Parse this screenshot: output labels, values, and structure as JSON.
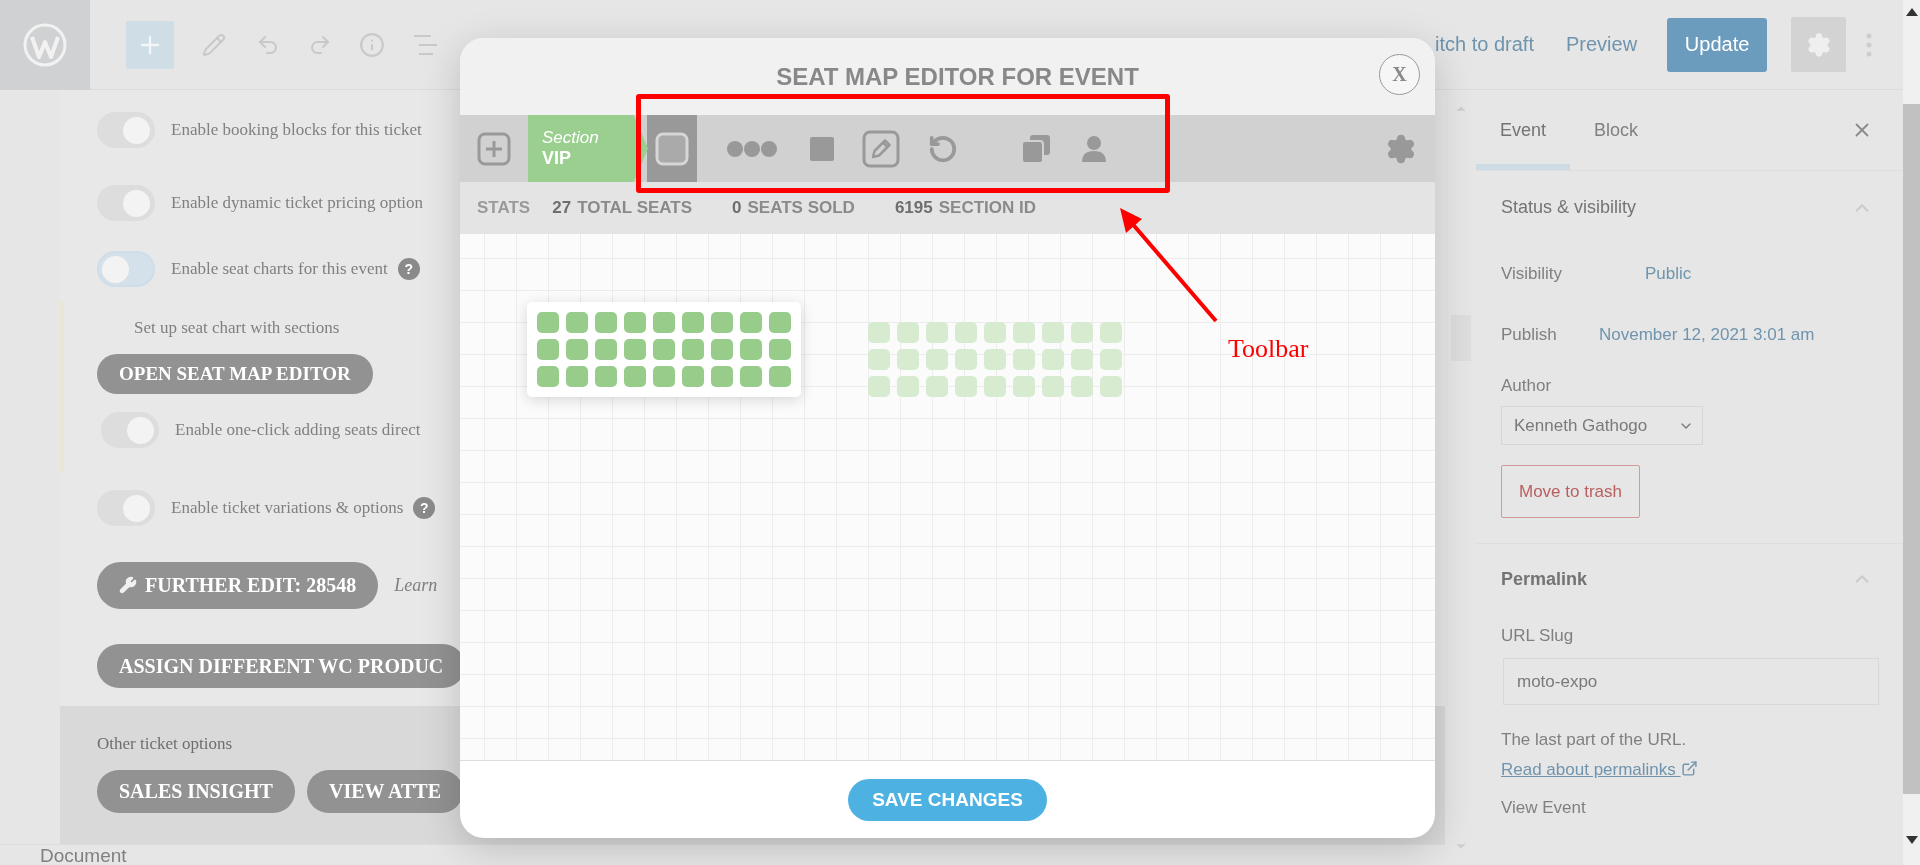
{
  "top_bar": {
    "switch_to_draft": "itch to draft",
    "preview": "Preview",
    "update": "Update"
  },
  "ticket_settings": {
    "toggles": [
      {
        "label": "Enable booking blocks for this ticket",
        "on": true
      },
      {
        "label": "Enable dynamic ticket pricing option",
        "on": true
      },
      {
        "label": "Enable seat charts for this event",
        "on": false,
        "help": "?"
      }
    ],
    "seat_chart": {
      "note": "Set up seat chart with sections",
      "button": "OPEN SEAT MAP EDITOR",
      "toggle": {
        "label": "Enable one-click adding seats direct",
        "on": true
      }
    },
    "variations": {
      "label": "Enable ticket variations & options",
      "on": true,
      "help": "?"
    },
    "further_edit": {
      "button": "FURTHER EDIT: 28548",
      "link": "Learn"
    },
    "assign_button": "ASSIGN DIFFERENT WC PRODUC",
    "other_options": {
      "title": "Other ticket options",
      "buttons": [
        "SALES INSIGHT",
        "VIEW ATTE"
      ]
    }
  },
  "footer": {
    "label": "Document"
  },
  "seat_map_editor": {
    "title": "SEAT MAP EDITOR FOR EVENT",
    "close": "X",
    "section": {
      "label": "Section",
      "name": "VIP"
    },
    "tools": [
      {
        "kind": "seat",
        "selected": true
      },
      {
        "kind": "row",
        "selected": false
      },
      {
        "kind": "block",
        "selected": false
      },
      {
        "kind": "edit",
        "selected": false
      },
      {
        "kind": "undo",
        "selected": false
      },
      {
        "kind": "copy",
        "selected": false
      },
      {
        "kind": "person",
        "selected": false
      }
    ],
    "stats_label": "STATS",
    "stats": [
      {
        "value": "27",
        "label": "TOTAL SEATS"
      },
      {
        "value": "0",
        "label": "SEATS SOLD"
      },
      {
        "value": "6195",
        "label": "SECTION ID"
      }
    ],
    "blocks": [
      {
        "selected": true
      },
      {
        "selected": false
      }
    ],
    "save": "SAVE CHANGES"
  },
  "annotation": {
    "label": "Toolbar"
  },
  "sidebar": {
    "tabs": [
      {
        "label": "Event",
        "selected": true
      },
      {
        "label": "Block",
        "selected": false
      }
    ],
    "status": {
      "title": "Status & visibility",
      "visibility_label": "Visibility",
      "visibility": "Public",
      "publish_label": "Publish",
      "publish": "November 12, 2021 3:01 am",
      "author_label": "Author",
      "author": "Kenneth Gathogo",
      "trash": "Move to trash"
    },
    "permalink": {
      "title": "Permalink",
      "slug_label": "URL Slug",
      "slug": "moto-expo",
      "help": "The last part of the URL.",
      "link": "Read about permalinks",
      "view": "View Event"
    }
  }
}
